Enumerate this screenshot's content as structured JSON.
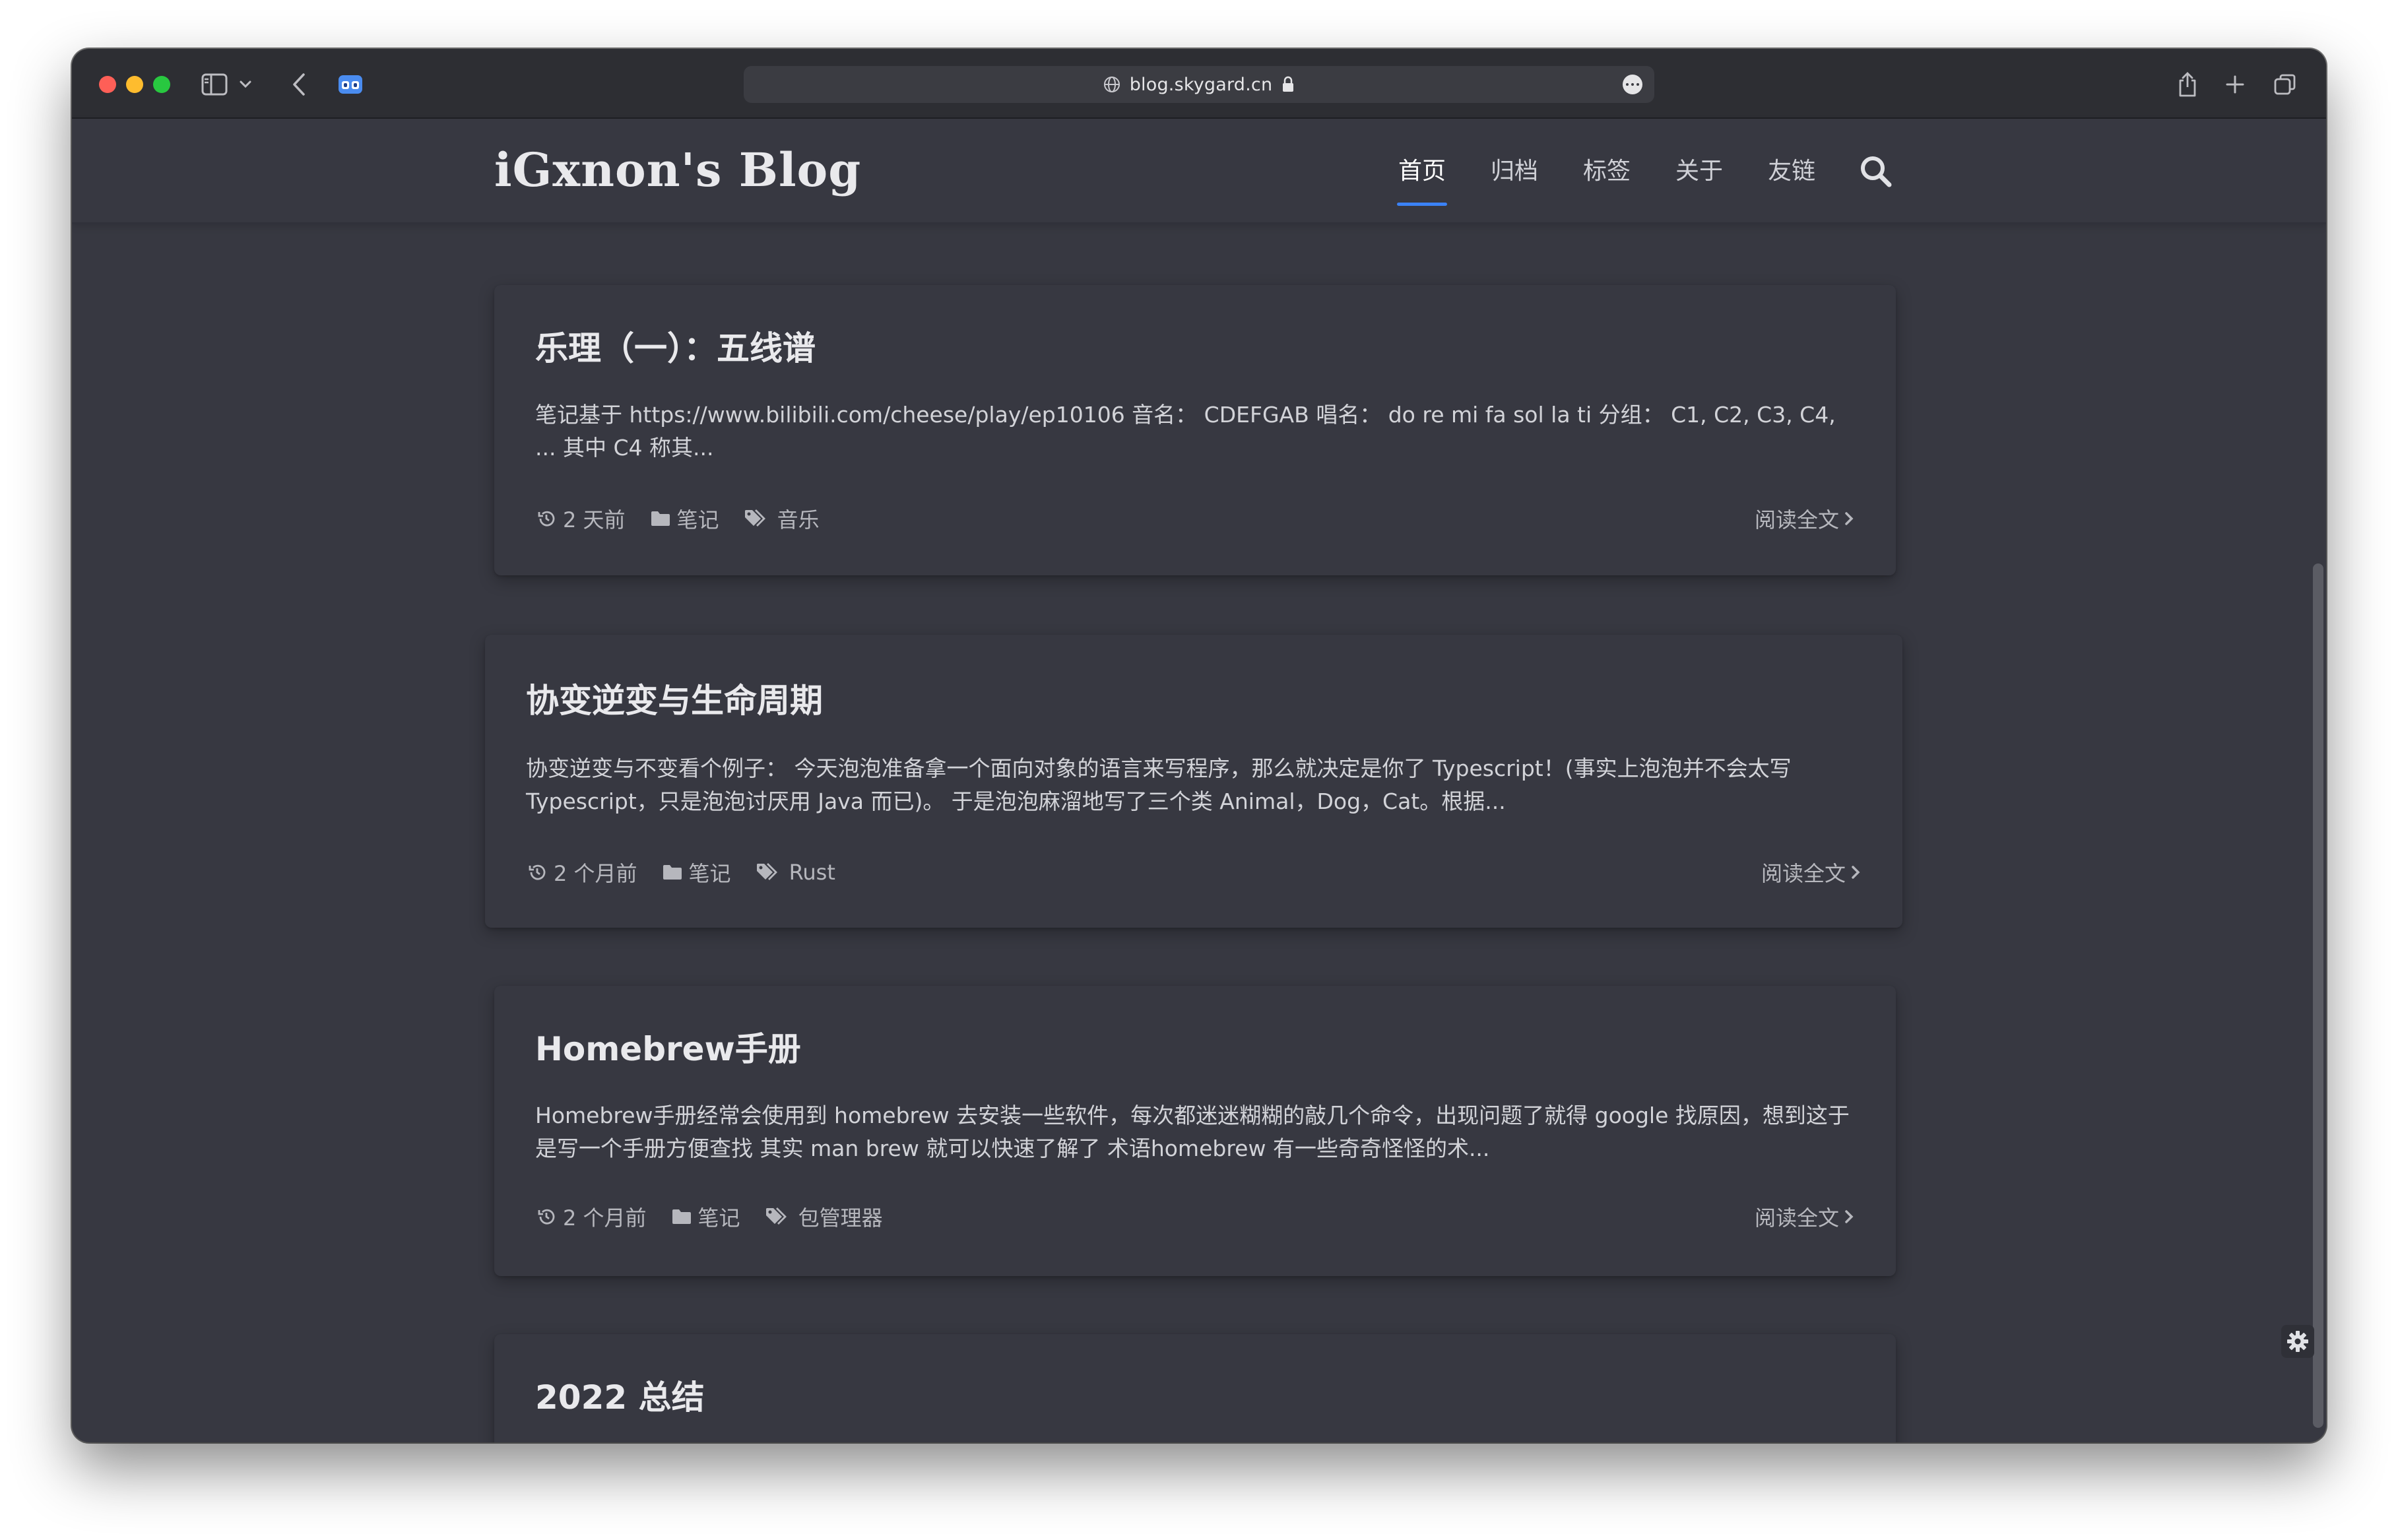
{
  "browser": {
    "url": "blog.skygard.cn"
  },
  "site": {
    "brand": "iGxnon's Blog",
    "nav": [
      {
        "label": "首页",
        "active": true
      },
      {
        "label": "归档",
        "active": false
      },
      {
        "label": "标签",
        "active": false
      },
      {
        "label": "关于",
        "active": false
      },
      {
        "label": "友链",
        "active": false
      }
    ]
  },
  "posts": [
    {
      "title": "乐理（一）：五线谱",
      "excerpt": "笔记基于 https://www.bilibili.com/cheese/play/ep10106 音名： CDEFGAB 唱名： do re mi fa sol la ti 分组： C1, C2, C3, C4, ... 其中 C4 称其...",
      "time": "2 天前",
      "category": "笔记",
      "tag": "音乐",
      "read_more": "阅读全文"
    },
    {
      "title": "协变逆变与生命周期",
      "excerpt": "协变逆变与不变看个例子： 今天泡泡准备拿一个面向对象的语言来写程序，那么就决定是你了 Typescript！(事实上泡泡并不会太写 Typescript，只是泡泡讨厌用 Java 而已)。 于是泡泡麻溜地写了三个类 Animal，Dog，Cat。根据...",
      "time": "2 个月前",
      "category": "笔记",
      "tag": "Rust",
      "read_more": "阅读全文"
    },
    {
      "title": "Homebrew手册",
      "excerpt": "Homebrew手册经常会使用到 homebrew 去安装一些软件，每次都迷迷糊糊的敲几个命令，出现问题了就得 google 找原因，想到这于是写一个手册方便查找 其实 man brew 就可以快速了解了 术语homebrew 有一些奇奇怪怪的术...",
      "time": "2 个月前",
      "category": "笔记",
      "tag": "包管理器",
      "read_more": "阅读全文"
    },
    {
      "title": "2022 总结"
    }
  ],
  "colors": {
    "background": "#373841",
    "accent": "#3b82f6",
    "chrome": "#2d2e33"
  }
}
